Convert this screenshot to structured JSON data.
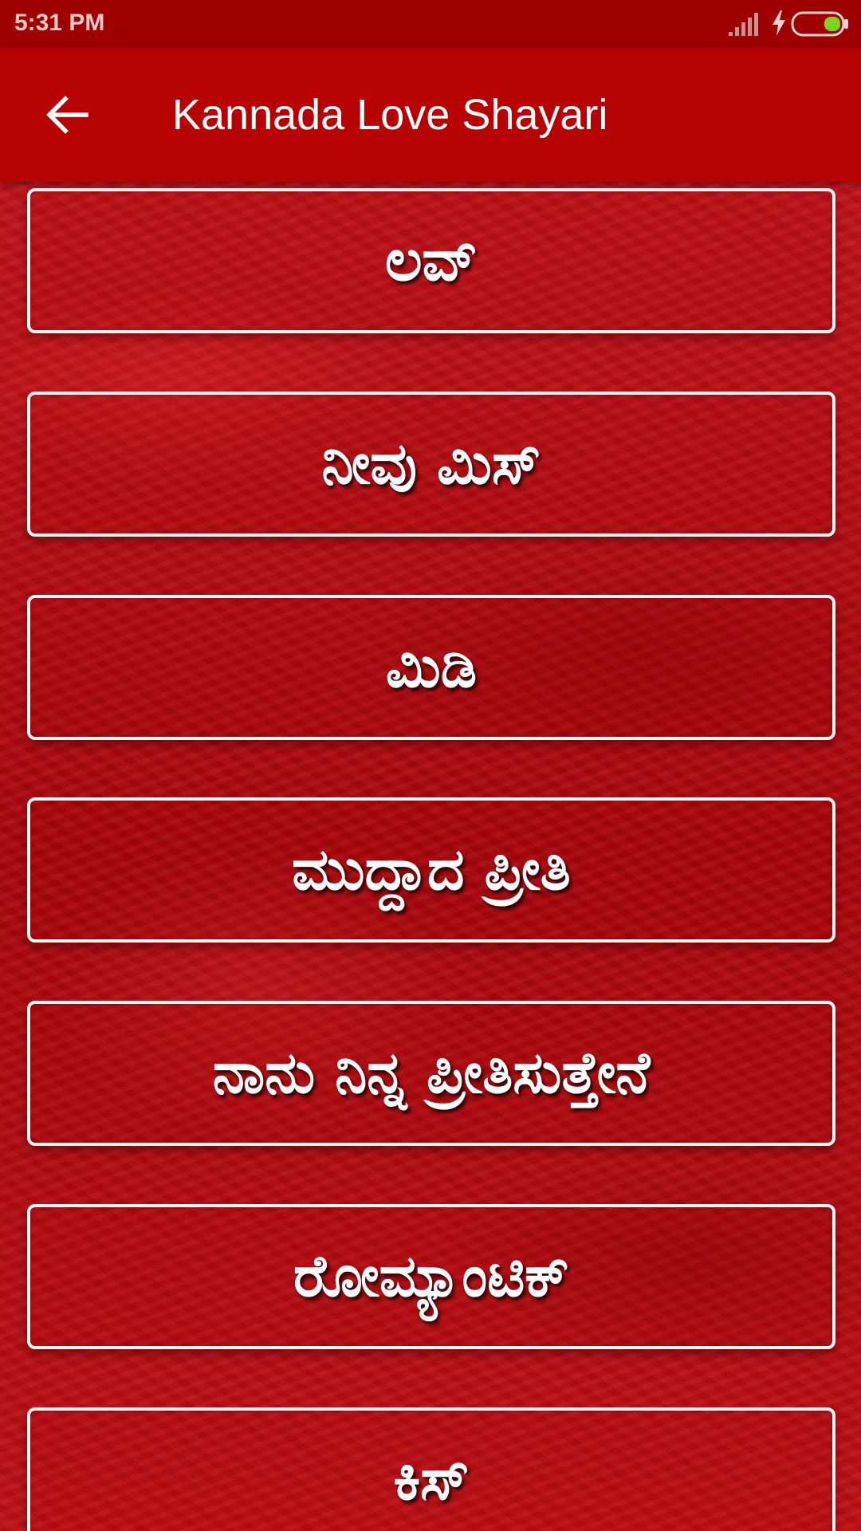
{
  "status_bar": {
    "time": "5:31 PM",
    "icons": [
      "signal-icon",
      "charging-icon",
      "battery-icon"
    ],
    "battery_color": "#7ed321"
  },
  "app_bar": {
    "title": "Kannada Love Shayari",
    "back_icon": "arrow-back-icon",
    "background_color": "#b60202"
  },
  "categories": [
    {
      "label": "ಲವ್"
    },
    {
      "label": "ನೀವು ಮಿಸ್"
    },
    {
      "label": "ಮಿಡಿ"
    },
    {
      "label": "ಮುದ್ದಾದ ಪ್ರೀತಿ"
    },
    {
      "label": "ನಾನು ನಿನ್ನ ಪ್ರೀತಿಸುತ್ತೇನೆ"
    },
    {
      "label": "ರೋಮ್ಯಾಂಟಿಕ್"
    },
    {
      "label": "ಕಿಸ್"
    }
  ]
}
